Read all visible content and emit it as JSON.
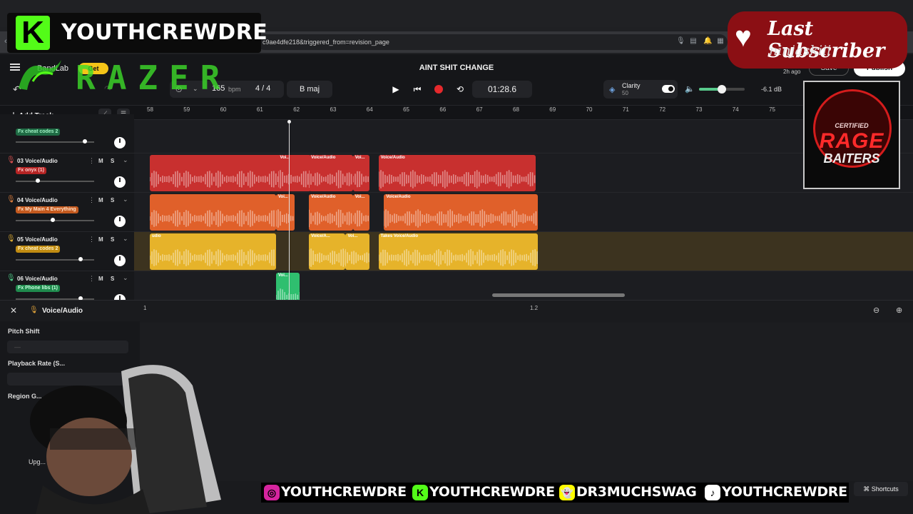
{
  "browser": {
    "url": "c9ae4dfe218&triggered_from=revision_page"
  },
  "app": {
    "brand": "BandLab",
    "get_label": "Get",
    "song_title": "AINT SHIT CHANGE",
    "saved_ago": "2h ago",
    "save_label": "Save",
    "publish_label": "Publish"
  },
  "toolbar": {
    "bpm": "165",
    "bpm_unit": "bpm",
    "time_signature": "4 / 4",
    "key": "B maj",
    "time": "01:28.6",
    "clarity_label": "Clarity",
    "clarity_value": "50",
    "volume_db": "-6.1 dB",
    "volume_level": 0.5
  },
  "timeline": {
    "add_track_label": "Add Track",
    "ruler": [
      "58",
      "59",
      "60",
      "61",
      "62",
      "63",
      "64",
      "65",
      "66",
      "67",
      "68",
      "69",
      "70",
      "71",
      "72",
      "73",
      "74",
      "75"
    ],
    "playhead_bar": 61.8
  },
  "tracks": [
    {
      "name": "",
      "fx": "Fx cheat codes 2",
      "color": "#7ee2a8",
      "fx_bg": "#1f6b44",
      "fx_fg": "#9ff0c3",
      "mic_color": "#6ad49a",
      "volume": 0.9,
      "clips": []
    },
    {
      "name": "03  Voice/Audio",
      "fx": "Fx onyx (1)",
      "color": "#c8302f",
      "fx_bg": "#b52424",
      "fx_fg": "#ffd0d0",
      "mic_color": "#e05252",
      "volume": 0.27,
      "clips": [
        {
          "label": "",
          "start": 58,
          "end": 62.4
        },
        {
          "label": "Voi...",
          "start": 61.5,
          "end": 61.95
        },
        {
          "label": "Voice/Audio",
          "start": 62.35,
          "end": 63.55
        },
        {
          "label": "Voi...",
          "start": 63.55,
          "end": 64.0
        },
        {
          "label": "Voice/Audio",
          "start": 64.25,
          "end": 68.55
        }
      ]
    },
    {
      "name": "04  Voice/Audio",
      "fx": "Fx My Main 4 Everything",
      "color": "#e0602a",
      "fx_bg": "#c45a1f",
      "fx_fg": "#ffe0c8",
      "mic_color": "#e3813e",
      "volume": 0.47,
      "clips": [
        {
          "label": "",
          "start": 58,
          "end": 61.45
        },
        {
          "label": "Voi...",
          "start": 61.45,
          "end": 61.95
        },
        {
          "label": "Voice/Audio",
          "start": 62.35,
          "end": 63.55
        },
        {
          "label": "Voi...",
          "start": 63.55,
          "end": 64.0
        },
        {
          "label": "Voice/Audio",
          "start": 64.4,
          "end": 68.6
        }
      ]
    },
    {
      "name": "05  Voice/Audio",
      "fx": "Fx cheat codes 2",
      "color": "#e6b32a",
      "fx_bg": "#c18c12",
      "fx_fg": "#fff3c8",
      "mic_color": "#e2b034",
      "volume": 0.85,
      "clips": [
        {
          "label": "udio",
          "start": 58,
          "end": 61.45
        },
        {
          "label": "Voice/A...",
          "start": 62.35,
          "end": 63.35
        },
        {
          "label": "Voi...",
          "start": 63.35,
          "end": 64.0
        },
        {
          "label": "Takes  Voice/Audio",
          "start": 64.25,
          "end": 68.6
        }
      ]
    },
    {
      "name": "06  Voice/Audio",
      "fx": "Fx Phone libs (1)",
      "color": "#2fbf6f",
      "fx_bg": "#1f8a4d",
      "fx_fg": "#c9ffe0",
      "mic_color": "#4fd18a",
      "volume": 0.85,
      "clips": [
        {
          "label": "Voi...",
          "start": 61.45,
          "end": 62.1
        }
      ]
    }
  ],
  "editor": {
    "title": "Voice/Audio",
    "pitch_shift_label": "Pitch Shift",
    "playback_rate_label": "Playback Rate (S...",
    "region_gain_label": "Region G...",
    "upgrade_label": "Upg...",
    "field_placeholder": "—",
    "ruler_1": "1",
    "ruler_2": "1.2",
    "shortcuts_label": "Shortcuts"
  },
  "overlay": {
    "channel": "YOUTHCREWDRE",
    "kick_letter": "K",
    "sponsor": "RAZER",
    "last_sub_title": "Last Subscriber",
    "last_sub_name": "ninjaskiii",
    "badge_top": "CERTIFIED",
    "badge_mid": "RAGE",
    "badge_bottom": "BAITERS",
    "socials": [
      {
        "icon": "instagram-icon",
        "handle": "YOUTHCREWDRE",
        "color": "#d6249f"
      },
      {
        "icon": "kick-icon",
        "handle": "YOUTHCREWDRE",
        "color": "#53fc18"
      },
      {
        "icon": "snapchat-icon",
        "handle": "DR3MUCHSWAG",
        "color": "#fffc00"
      },
      {
        "icon": "tiktok-icon",
        "handle": "YOUTHCREWDRE",
        "color": "#ffffff"
      }
    ]
  }
}
